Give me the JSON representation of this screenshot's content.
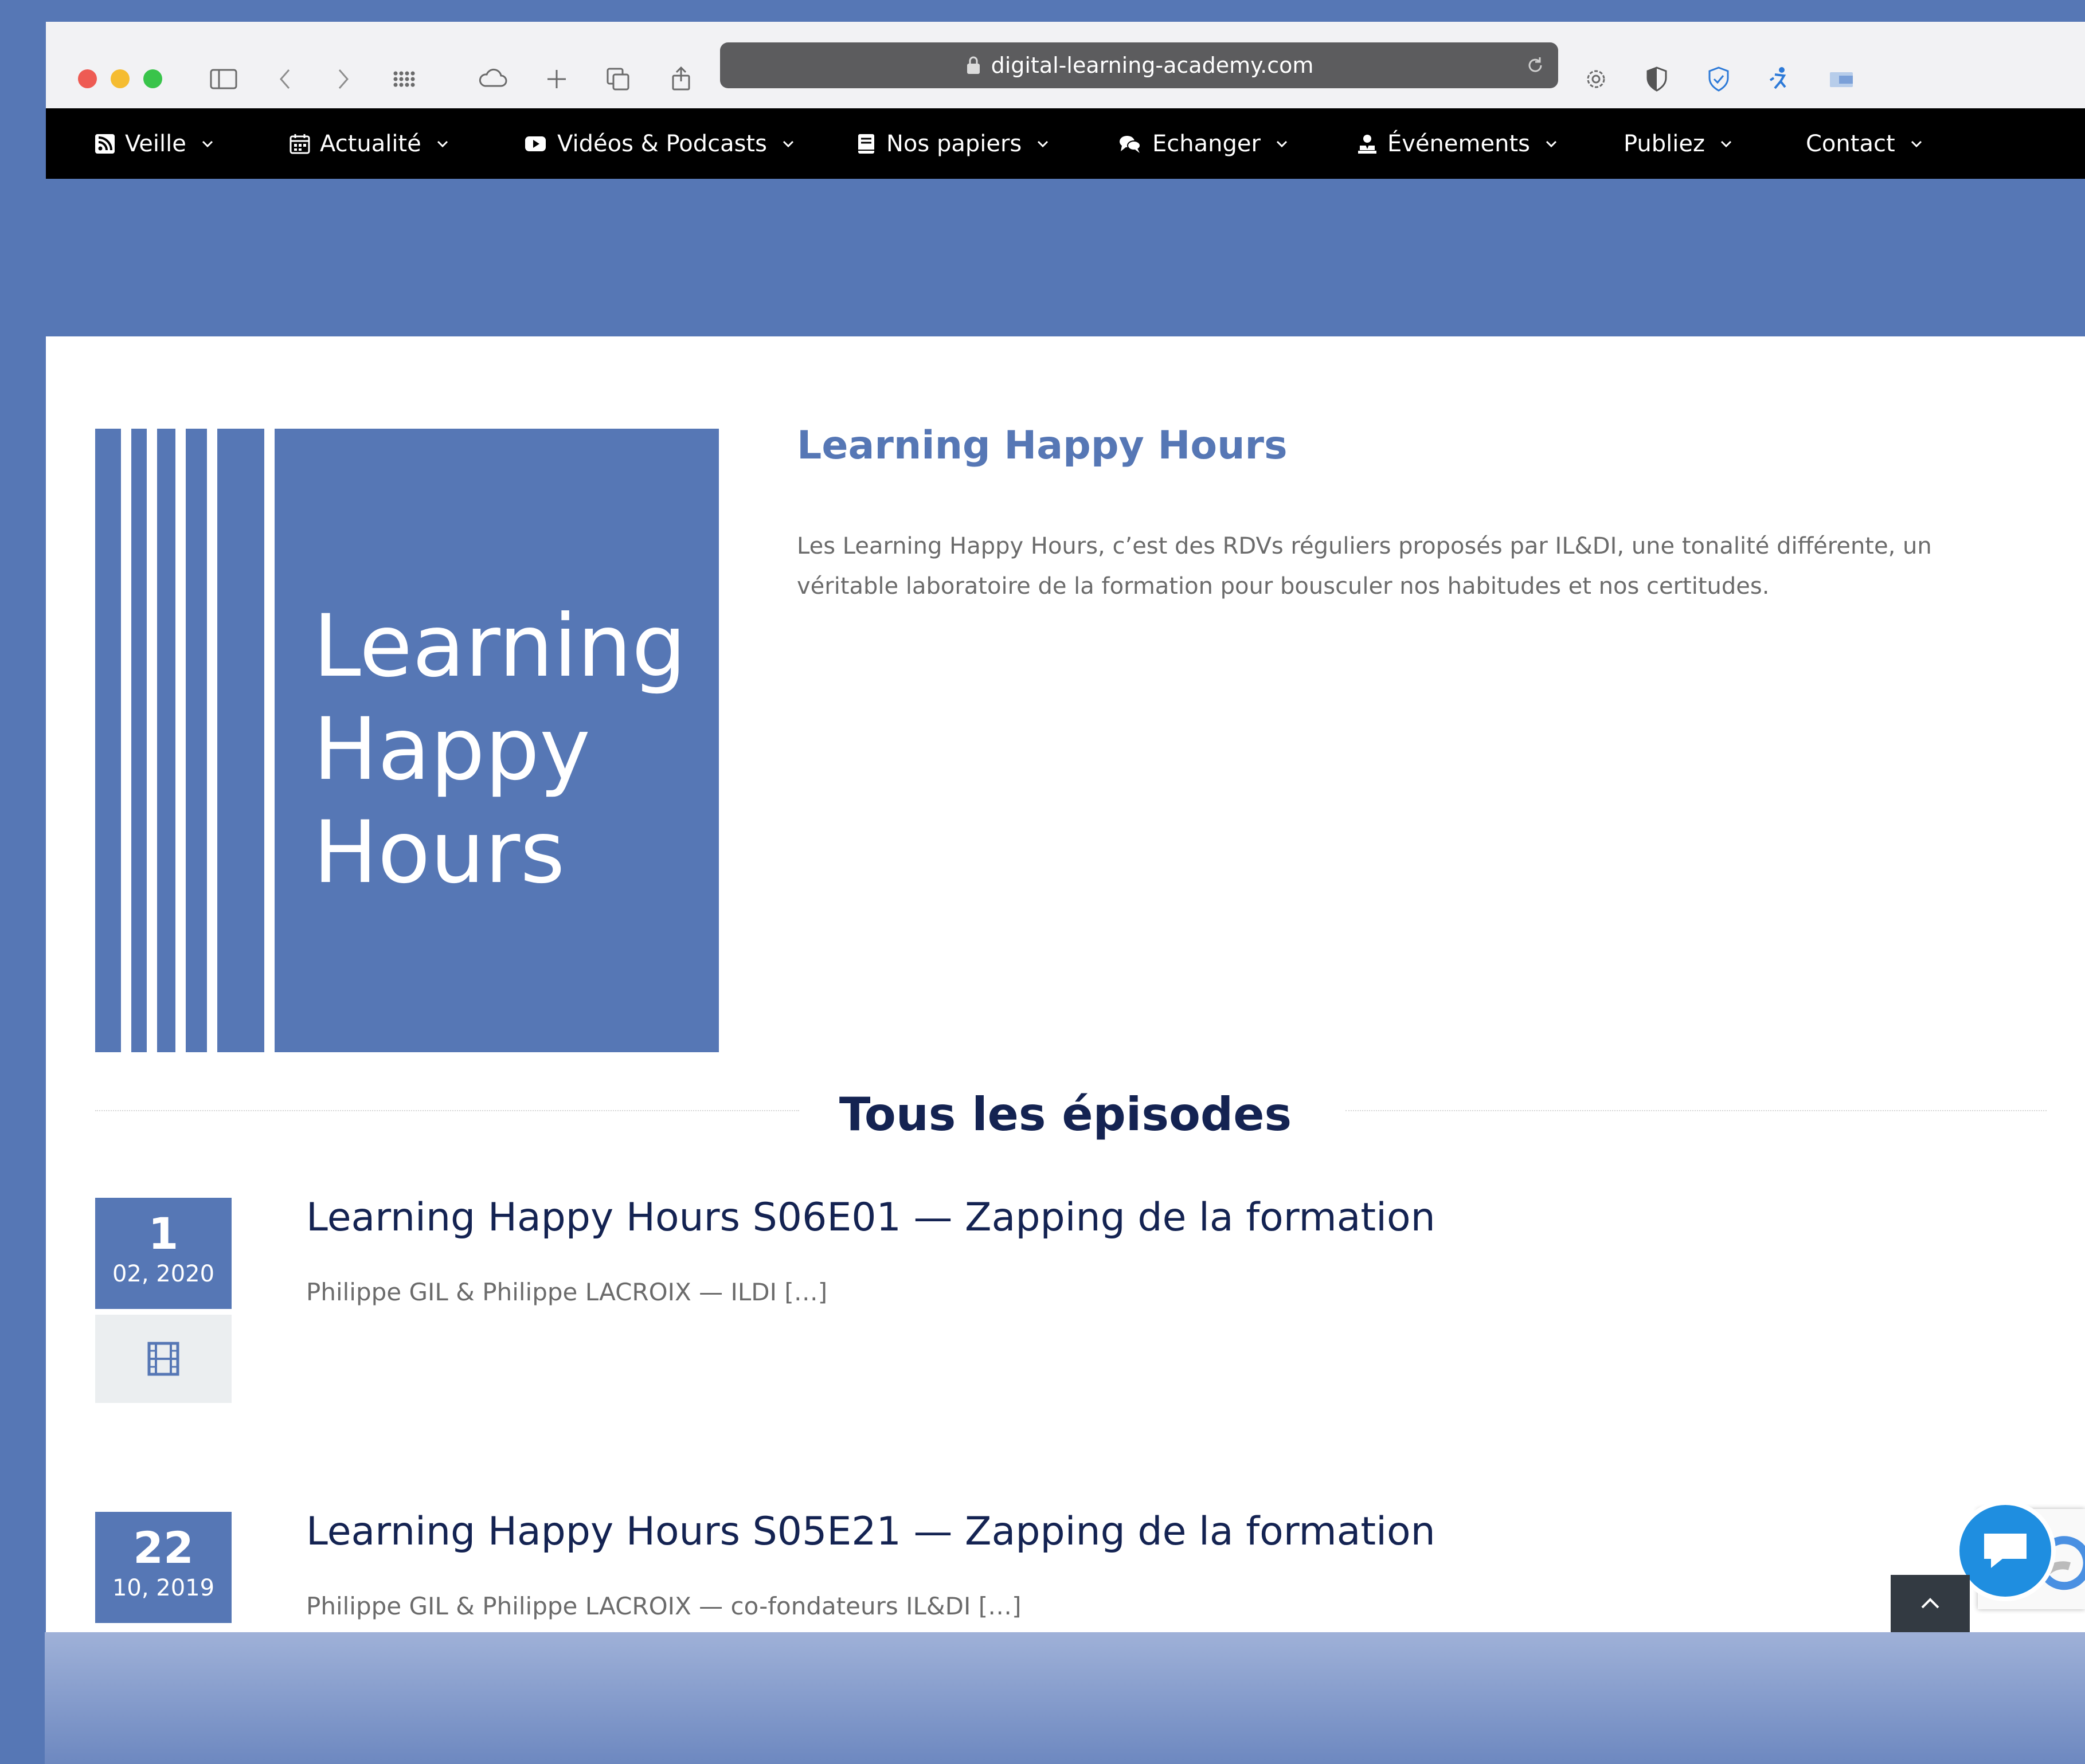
{
  "browser": {
    "url": "digital-learning-academy.com"
  },
  "nav": {
    "items": [
      {
        "label": "Veille",
        "icon": "rss-icon"
      },
      {
        "label": "Actualité",
        "icon": "calendar-icon"
      },
      {
        "label": "Vidéos & Podcasts",
        "icon": "youtube-icon"
      },
      {
        "label": "Nos papiers",
        "icon": "book-icon"
      },
      {
        "label": "Echanger",
        "icon": "comments-icon"
      },
      {
        "label": "Événements",
        "icon": "presenter-icon"
      },
      {
        "label": "Publiez",
        "icon": ""
      },
      {
        "label": "Contact",
        "icon": ""
      }
    ]
  },
  "hero": {
    "image_text": [
      "Learning",
      "Happy",
      "Hours"
    ],
    "title": "Learning Happy Hours",
    "description": "Les Learning Happy Hours, c’est des RDVs réguliers proposés par IL&DI, une tonalité différente, un véritable laboratoire de la formation pour bousculer nos habitudes et nos certitudes."
  },
  "episodes_section": {
    "title": "Tous les épisodes"
  },
  "episodes": [
    {
      "day": "1",
      "month_year": "02, 2020",
      "type_icon": "film-icon",
      "title": "Learning Happy Hours S06E01 — Zapping de la formation",
      "excerpt": "Philippe GIL & Philippe LACROIX — ILDI […]"
    },
    {
      "day": "22",
      "month_year": "10, 2019",
      "type_icon": "film-icon",
      "title": "Learning Happy Hours S05E21 — Zapping de la formation",
      "excerpt": "Philippe GIL & Philippe LACROIX — co-fondateurs IL&DI […]"
    }
  ],
  "colors": {
    "brand_blue": "#5677b5",
    "dark_navy": "#142352",
    "nav_bg": "#000000",
    "chat_blue": "#1f8ee0"
  }
}
